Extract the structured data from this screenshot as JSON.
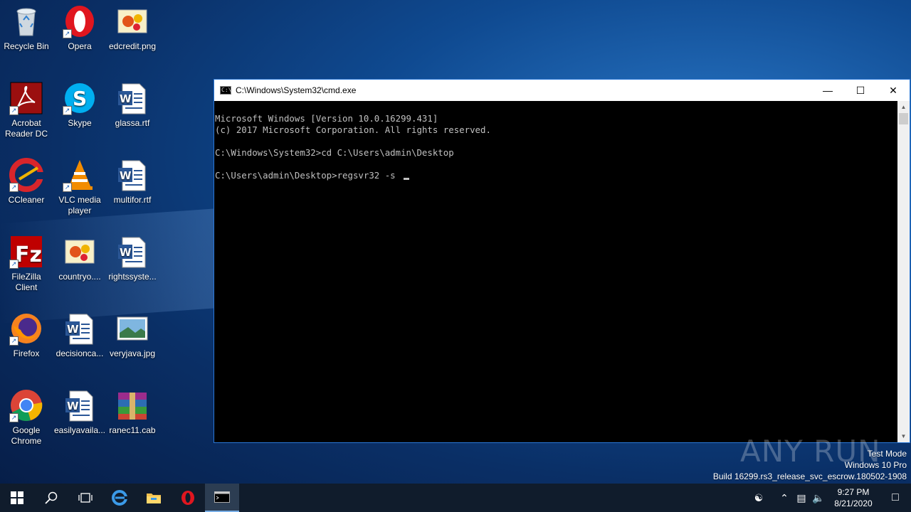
{
  "desktop": {
    "icons": [
      {
        "label": "Recycle Bin",
        "icon": "recycle-bin-icon"
      },
      {
        "label": "Opera",
        "icon": "opera-icon"
      },
      {
        "label": "edcredit.png",
        "icon": "image-file-icon"
      },
      {
        "label": "Acrobat Reader DC",
        "icon": "acrobat-icon"
      },
      {
        "label": "Skype",
        "icon": "skype-icon"
      },
      {
        "label": "glassa.rtf",
        "icon": "word-document-icon"
      },
      {
        "label": "CCleaner",
        "icon": "ccleaner-icon"
      },
      {
        "label": "VLC media player",
        "icon": "vlc-icon"
      },
      {
        "label": "multifor.rtf",
        "icon": "word-document-icon"
      },
      {
        "label": "FileZilla Client",
        "icon": "filezilla-icon"
      },
      {
        "label": "countryo....",
        "icon": "image-file-icon"
      },
      {
        "label": "rightssyste...",
        "icon": "word-document-icon"
      },
      {
        "label": "Firefox",
        "icon": "firefox-icon"
      },
      {
        "label": "decisionca...",
        "icon": "word-document-icon"
      },
      {
        "label": "veryjava.jpg",
        "icon": "landscape-image-icon"
      },
      {
        "label": "Google Chrome",
        "icon": "chrome-icon"
      },
      {
        "label": "easilyavaila...",
        "icon": "word-document-icon"
      },
      {
        "label": "ranec11.cab",
        "icon": "winrar-archive-icon"
      }
    ]
  },
  "cmd": {
    "title": "C:\\Windows\\System32\\cmd.exe",
    "lines": [
      "Microsoft Windows [Version 10.0.16299.431]",
      "(c) 2017 Microsoft Corporation. All rights reserved.",
      "",
      "C:\\Windows\\System32>cd C:\\Users\\admin\\Desktop",
      "",
      "C:\\Users\\admin\\Desktop>regsvr32 -s "
    ],
    "minimize": "—",
    "maximize": "☐",
    "close": "✕"
  },
  "watermark": {
    "line1": "Test Mode",
    "line2": "Windows 10 Pro",
    "line3": "Build 16299.rs3_release_svc_escrow.180502-1908",
    "brand": "ANY RUN"
  },
  "taskbar": {
    "time": "9:27 PM",
    "date": "8/21/2020"
  },
  "colors": {
    "console_bg": "#000000",
    "console_text": "#c0c0c0",
    "taskbar_bg": "#101c2c",
    "window_border": "#2a78d8"
  }
}
